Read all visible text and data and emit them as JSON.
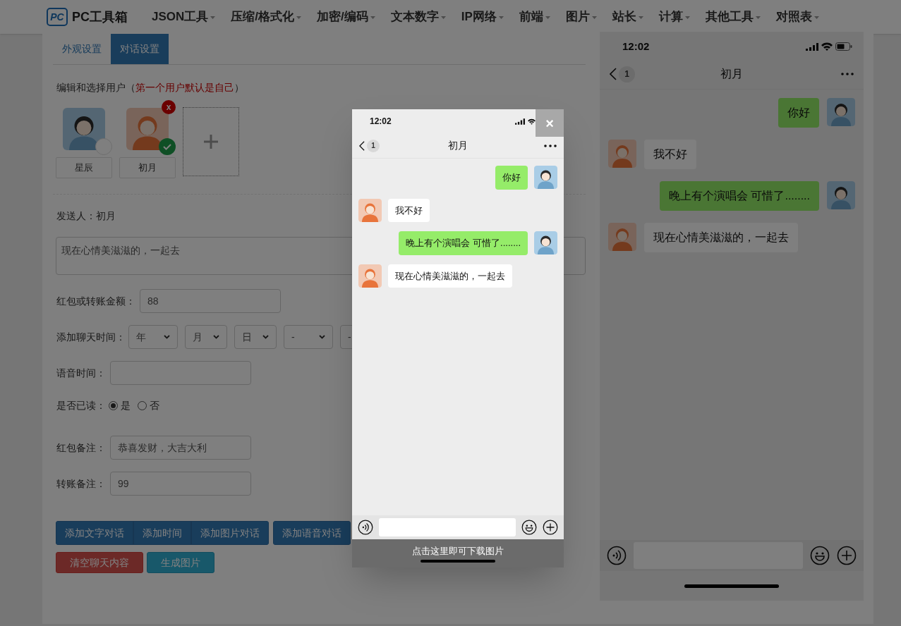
{
  "nav": {
    "logo_mark": "PC",
    "logo_text": "PC工具箱",
    "menu": [
      "JSON工具",
      "压缩/格式化",
      "加密/编码",
      "文本数字",
      "IP网络",
      "前端",
      "图片",
      "站长",
      "计算",
      "其他工具",
      "对照表"
    ]
  },
  "tabs": [
    {
      "label": "外观设置",
      "selected": false
    },
    {
      "label": "对话设置",
      "selected": true
    }
  ],
  "users_section": {
    "heading": "编辑和选择用户（",
    "note": "第一个用户默认是自己",
    "heading_end": "）"
  },
  "users": [
    {
      "name": "星辰",
      "selected": false,
      "kind": "boy"
    },
    {
      "name": "初月",
      "selected": true,
      "kind": "girl",
      "delete_label": "x"
    }
  ],
  "sender": "发送人：初月",
  "message_field": {
    "value": "现在心情美滋滋的，一起去"
  },
  "amount": {
    "label": "红包或转账金额：",
    "value": "88"
  },
  "chat_time": {
    "label": "添加聊天时间：",
    "selects": [
      "年",
      "月",
      "日",
      "-",
      "-"
    ]
  },
  "voice_time": {
    "label": "语音时间："
  },
  "read": {
    "label": "是否已读：",
    "options": [
      {
        "label": "是",
        "selected": true
      },
      {
        "label": "否",
        "selected": false
      }
    ]
  },
  "red_packet_note": {
    "label": "红包备注：",
    "value": "恭喜发财，大吉大利"
  },
  "transfer_note": {
    "label": "转账备注：",
    "value": "99"
  },
  "action_button_groups": [
    [
      {
        "label": "添加文字对话",
        "kind": "primary"
      },
      {
        "label": "添加时间",
        "kind": "primary"
      },
      {
        "label": "添加图片对话",
        "kind": "primary"
      }
    ],
    [
      {
        "label": "添加语音对话",
        "kind": "primary"
      }
    ]
  ],
  "output_buttons": [
    {
      "label": "清空聊天内容",
      "kind": "danger"
    },
    {
      "label": "生成图片",
      "kind": "info"
    }
  ],
  "preview": {
    "time": "12:02",
    "back_count": "1",
    "title": "初月",
    "messages": [
      {
        "kind": "sent",
        "text": "你好"
      },
      {
        "kind": "received",
        "text": "我不好"
      },
      {
        "kind": "sent",
        "text": "晚上有个演唱会 可惜了........"
      },
      {
        "kind": "received",
        "text": "现在心情美滋滋的，一起去"
      }
    ]
  },
  "modal": {
    "close": "×",
    "caption": "点击这里即可下载图片",
    "phone": {
      "time": "12:02",
      "back_count": "1",
      "title": "初月",
      "messages": [
        {
          "kind": "sent",
          "text": "你好"
        },
        {
          "kind": "received",
          "text": "我不好"
        },
        {
          "kind": "sent",
          "text": "晚上有个演唱会 可惜了........"
        },
        {
          "kind": "received",
          "text": "现在心情美滋滋的，一起去"
        }
      ]
    }
  }
}
